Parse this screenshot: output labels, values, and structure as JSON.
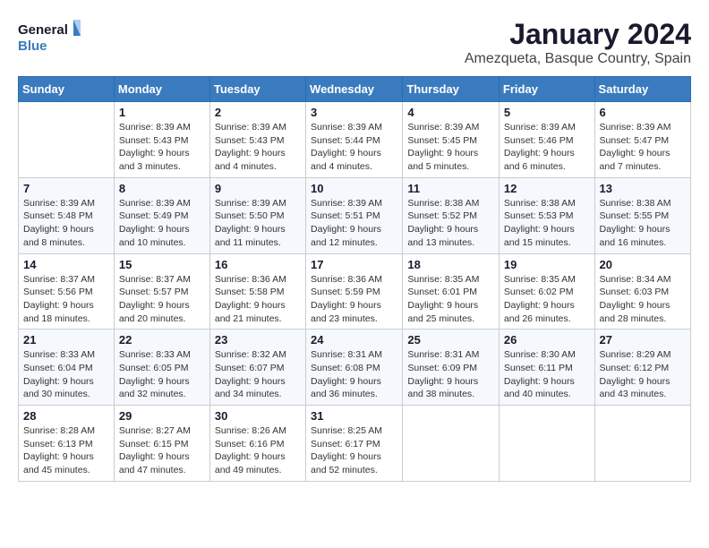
{
  "logo": {
    "line1": "General",
    "line2": "Blue"
  },
  "title": "January 2024",
  "subtitle": "Amezqueta, Basque Country, Spain",
  "days_of_week": [
    "Sunday",
    "Monday",
    "Tuesday",
    "Wednesday",
    "Thursday",
    "Friday",
    "Saturday"
  ],
  "weeks": [
    [
      {
        "day": "",
        "sunrise": "",
        "sunset": "",
        "daylight": ""
      },
      {
        "day": "1",
        "sunrise": "Sunrise: 8:39 AM",
        "sunset": "Sunset: 5:43 PM",
        "daylight": "Daylight: 9 hours and 3 minutes."
      },
      {
        "day": "2",
        "sunrise": "Sunrise: 8:39 AM",
        "sunset": "Sunset: 5:43 PM",
        "daylight": "Daylight: 9 hours and 4 minutes."
      },
      {
        "day": "3",
        "sunrise": "Sunrise: 8:39 AM",
        "sunset": "Sunset: 5:44 PM",
        "daylight": "Daylight: 9 hours and 4 minutes."
      },
      {
        "day": "4",
        "sunrise": "Sunrise: 8:39 AM",
        "sunset": "Sunset: 5:45 PM",
        "daylight": "Daylight: 9 hours and 5 minutes."
      },
      {
        "day": "5",
        "sunrise": "Sunrise: 8:39 AM",
        "sunset": "Sunset: 5:46 PM",
        "daylight": "Daylight: 9 hours and 6 minutes."
      },
      {
        "day": "6",
        "sunrise": "Sunrise: 8:39 AM",
        "sunset": "Sunset: 5:47 PM",
        "daylight": "Daylight: 9 hours and 7 minutes."
      }
    ],
    [
      {
        "day": "7",
        "sunrise": "Sunrise: 8:39 AM",
        "sunset": "Sunset: 5:48 PM",
        "daylight": "Daylight: 9 hours and 8 minutes."
      },
      {
        "day": "8",
        "sunrise": "Sunrise: 8:39 AM",
        "sunset": "Sunset: 5:49 PM",
        "daylight": "Daylight: 9 hours and 10 minutes."
      },
      {
        "day": "9",
        "sunrise": "Sunrise: 8:39 AM",
        "sunset": "Sunset: 5:50 PM",
        "daylight": "Daylight: 9 hours and 11 minutes."
      },
      {
        "day": "10",
        "sunrise": "Sunrise: 8:39 AM",
        "sunset": "Sunset: 5:51 PM",
        "daylight": "Daylight: 9 hours and 12 minutes."
      },
      {
        "day": "11",
        "sunrise": "Sunrise: 8:38 AM",
        "sunset": "Sunset: 5:52 PM",
        "daylight": "Daylight: 9 hours and 13 minutes."
      },
      {
        "day": "12",
        "sunrise": "Sunrise: 8:38 AM",
        "sunset": "Sunset: 5:53 PM",
        "daylight": "Daylight: 9 hours and 15 minutes."
      },
      {
        "day": "13",
        "sunrise": "Sunrise: 8:38 AM",
        "sunset": "Sunset: 5:55 PM",
        "daylight": "Daylight: 9 hours and 16 minutes."
      }
    ],
    [
      {
        "day": "14",
        "sunrise": "Sunrise: 8:37 AM",
        "sunset": "Sunset: 5:56 PM",
        "daylight": "Daylight: 9 hours and 18 minutes."
      },
      {
        "day": "15",
        "sunrise": "Sunrise: 8:37 AM",
        "sunset": "Sunset: 5:57 PM",
        "daylight": "Daylight: 9 hours and 20 minutes."
      },
      {
        "day": "16",
        "sunrise": "Sunrise: 8:36 AM",
        "sunset": "Sunset: 5:58 PM",
        "daylight": "Daylight: 9 hours and 21 minutes."
      },
      {
        "day": "17",
        "sunrise": "Sunrise: 8:36 AM",
        "sunset": "Sunset: 5:59 PM",
        "daylight": "Daylight: 9 hours and 23 minutes."
      },
      {
        "day": "18",
        "sunrise": "Sunrise: 8:35 AM",
        "sunset": "Sunset: 6:01 PM",
        "daylight": "Daylight: 9 hours and 25 minutes."
      },
      {
        "day": "19",
        "sunrise": "Sunrise: 8:35 AM",
        "sunset": "Sunset: 6:02 PM",
        "daylight": "Daylight: 9 hours and 26 minutes."
      },
      {
        "day": "20",
        "sunrise": "Sunrise: 8:34 AM",
        "sunset": "Sunset: 6:03 PM",
        "daylight": "Daylight: 9 hours and 28 minutes."
      }
    ],
    [
      {
        "day": "21",
        "sunrise": "Sunrise: 8:33 AM",
        "sunset": "Sunset: 6:04 PM",
        "daylight": "Daylight: 9 hours and 30 minutes."
      },
      {
        "day": "22",
        "sunrise": "Sunrise: 8:33 AM",
        "sunset": "Sunset: 6:05 PM",
        "daylight": "Daylight: 9 hours and 32 minutes."
      },
      {
        "day": "23",
        "sunrise": "Sunrise: 8:32 AM",
        "sunset": "Sunset: 6:07 PM",
        "daylight": "Daylight: 9 hours and 34 minutes."
      },
      {
        "day": "24",
        "sunrise": "Sunrise: 8:31 AM",
        "sunset": "Sunset: 6:08 PM",
        "daylight": "Daylight: 9 hours and 36 minutes."
      },
      {
        "day": "25",
        "sunrise": "Sunrise: 8:31 AM",
        "sunset": "Sunset: 6:09 PM",
        "daylight": "Daylight: 9 hours and 38 minutes."
      },
      {
        "day": "26",
        "sunrise": "Sunrise: 8:30 AM",
        "sunset": "Sunset: 6:11 PM",
        "daylight": "Daylight: 9 hours and 40 minutes."
      },
      {
        "day": "27",
        "sunrise": "Sunrise: 8:29 AM",
        "sunset": "Sunset: 6:12 PM",
        "daylight": "Daylight: 9 hours and 43 minutes."
      }
    ],
    [
      {
        "day": "28",
        "sunrise": "Sunrise: 8:28 AM",
        "sunset": "Sunset: 6:13 PM",
        "daylight": "Daylight: 9 hours and 45 minutes."
      },
      {
        "day": "29",
        "sunrise": "Sunrise: 8:27 AM",
        "sunset": "Sunset: 6:15 PM",
        "daylight": "Daylight: 9 hours and 47 minutes."
      },
      {
        "day": "30",
        "sunrise": "Sunrise: 8:26 AM",
        "sunset": "Sunset: 6:16 PM",
        "daylight": "Daylight: 9 hours and 49 minutes."
      },
      {
        "day": "31",
        "sunrise": "Sunrise: 8:25 AM",
        "sunset": "Sunset: 6:17 PM",
        "daylight": "Daylight: 9 hours and 52 minutes."
      },
      {
        "day": "",
        "sunrise": "",
        "sunset": "",
        "daylight": ""
      },
      {
        "day": "",
        "sunrise": "",
        "sunset": "",
        "daylight": ""
      },
      {
        "day": "",
        "sunrise": "",
        "sunset": "",
        "daylight": ""
      }
    ]
  ]
}
